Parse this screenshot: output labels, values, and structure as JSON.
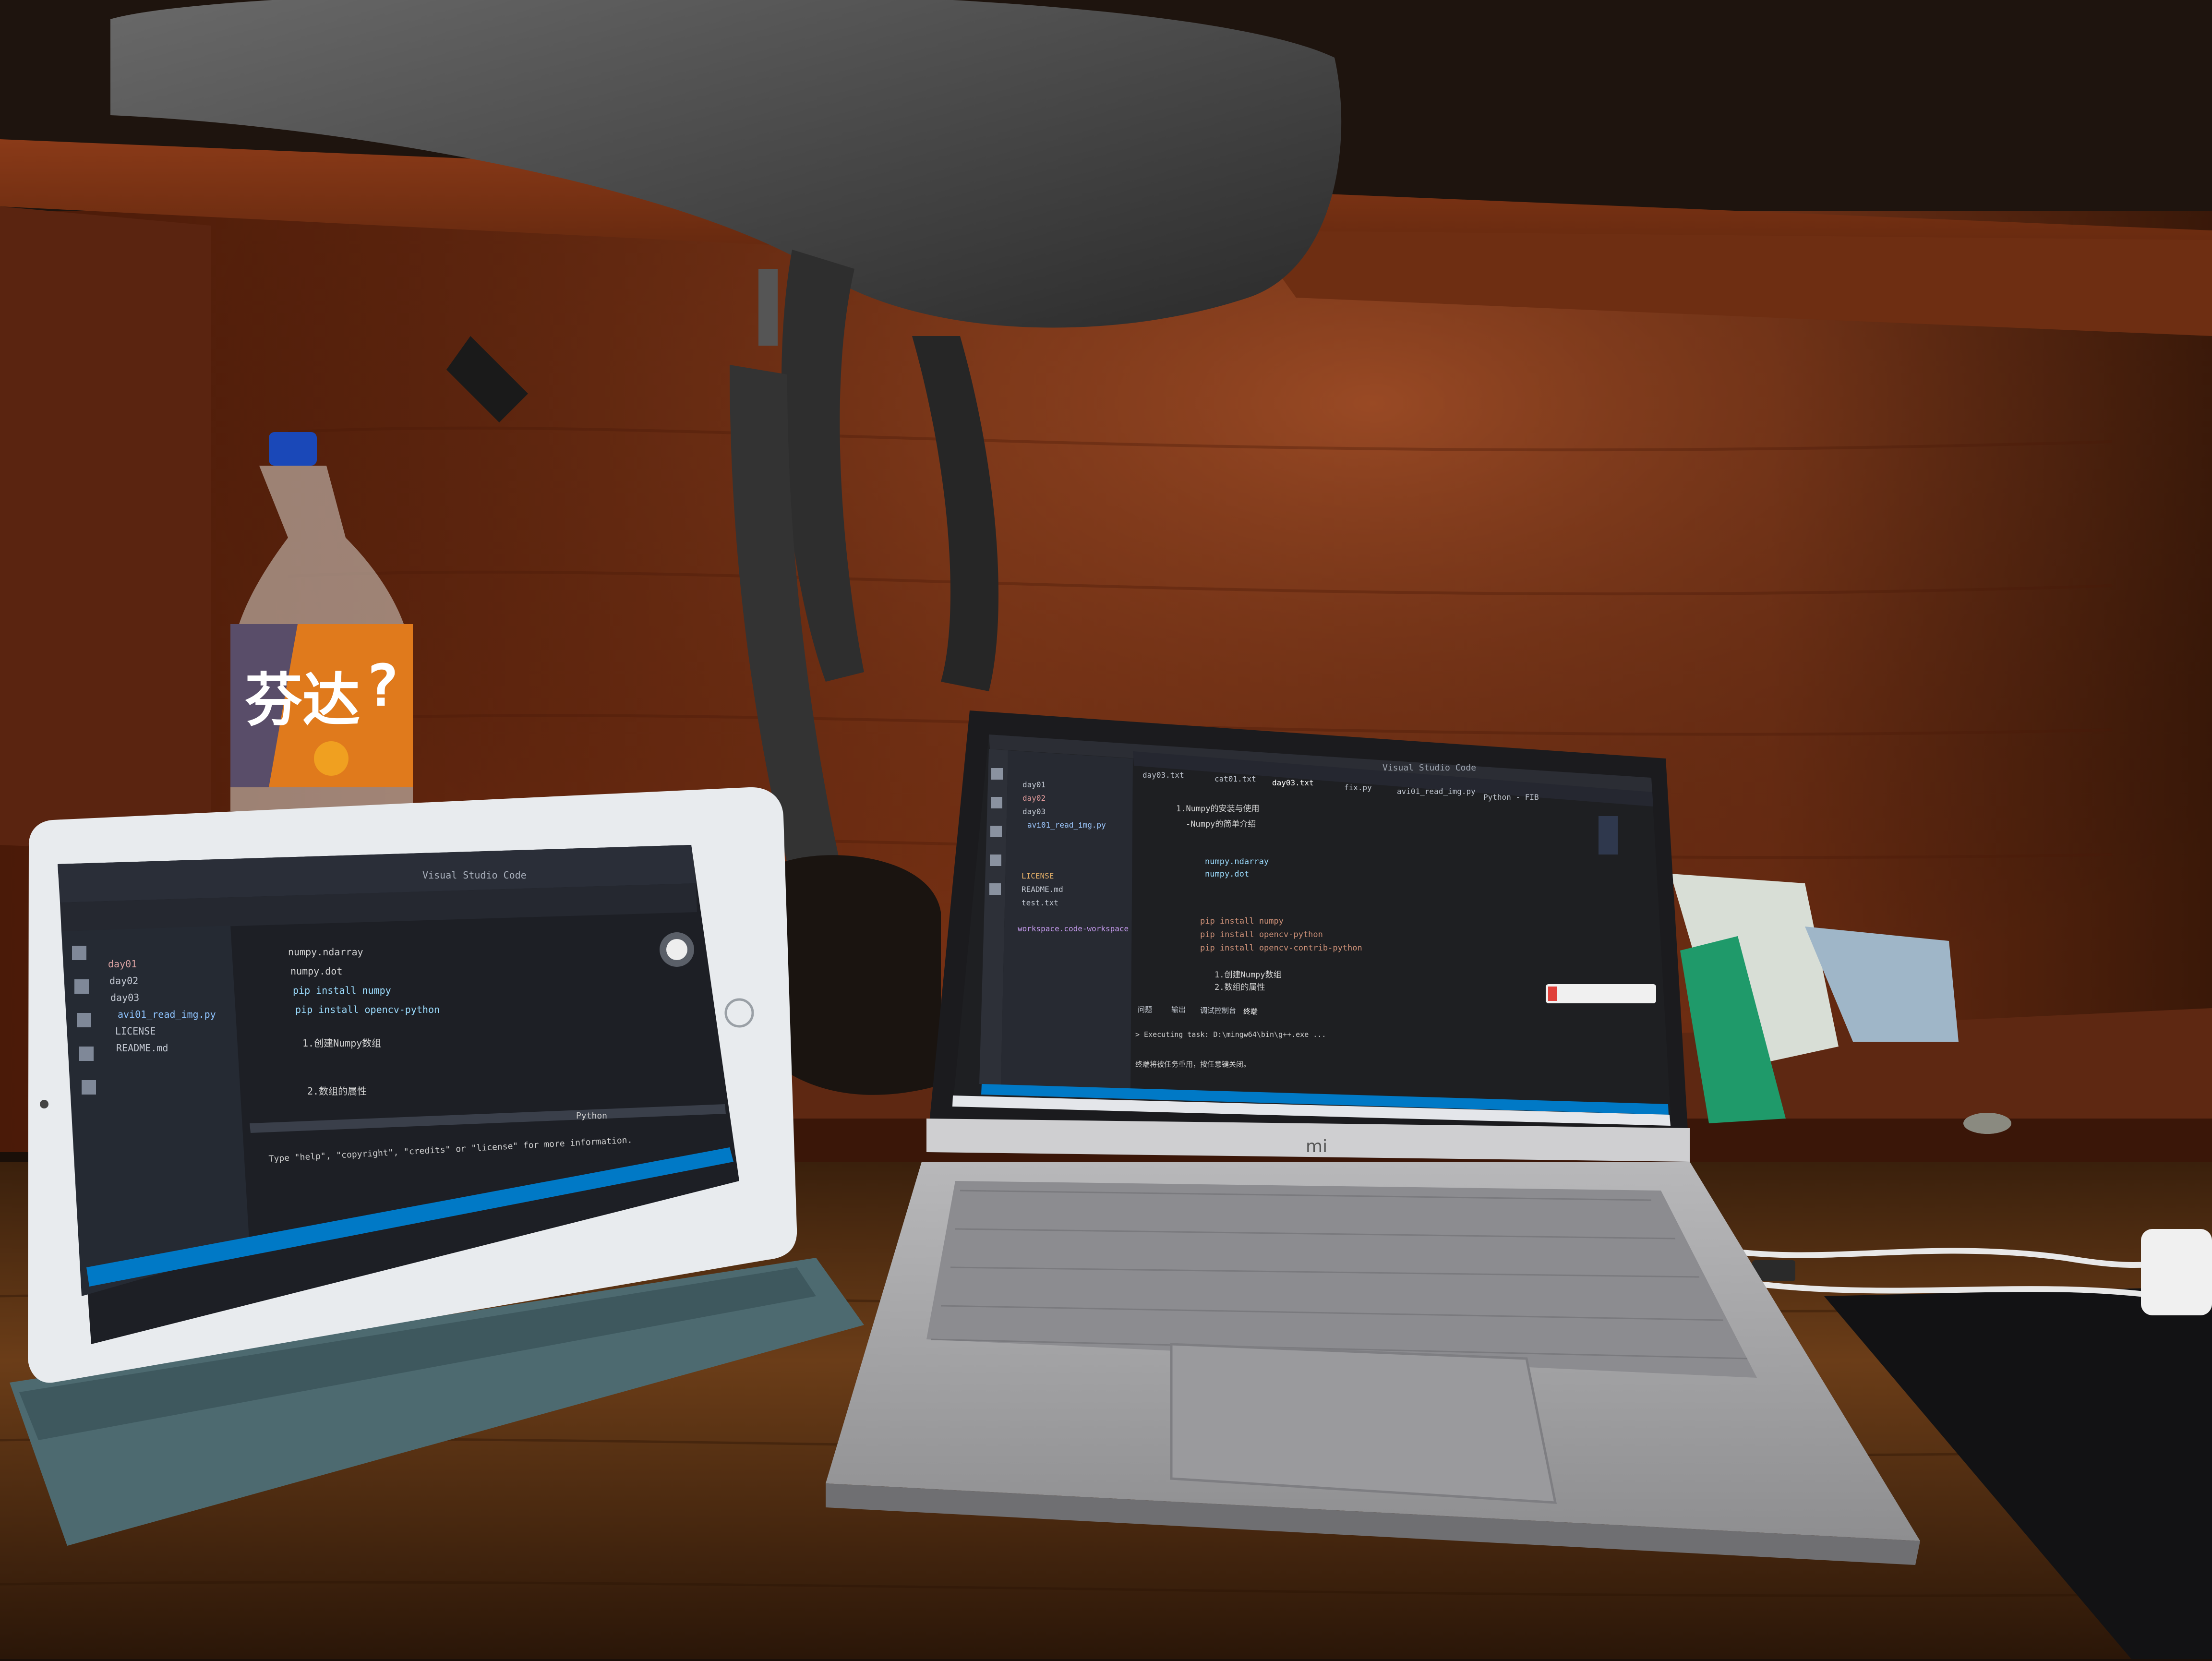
{
  "scene": {
    "description_tags": [
      "desk",
      "laptop",
      "tablet",
      "bottle",
      "backpack"
    ]
  },
  "bottle": {
    "brand_text": "芬达",
    "brand_mark": "?"
  },
  "laptop": {
    "logo": "mi",
    "window_title": "Visual Studio Code",
    "terminal_line": "> Executing task: D:\\mingw64\\bin\\g++.exe ...",
    "terminal_note": "终端将被任务重用，按任意键关闭。",
    "editor_lines": [
      "1.Numpy的安装与使用",
      "  -Numpy的简单介绍",
      "numpy.ndarray",
      "numpy.dot",
      "pip install numpy",
      "pip install opencv-python",
      "pip install opencv-contrib-python",
      "1.创建Numpy数组",
      "2.数组的属性"
    ],
    "panel_tabs": [
      "问题",
      "输出",
      "调试控制台",
      "终端"
    ],
    "tab_labels": [
      "day03.txt",
      "cat01.txt",
      "day03.txt",
      "fix.py",
      "avi01_read_img.py",
      "Python - FIB"
    ],
    "sidebar_items": [
      "day01",
      "day02",
      "day03",
      "avi01_read_img.py",
      "LICENSE",
      "README.md",
      "test.txt",
      "workspace.code-workspace"
    ]
  },
  "tablet": {
    "window_title": "Visual Studio Code",
    "sidebar_items": [
      "day01",
      "day02",
      "day03",
      "avi01_read_img.py",
      "LICENSE",
      "README.md"
    ],
    "editor_lines": [
      "numpy.ndarray",
      "numpy.dot",
      "pip install numpy",
      "pip install opencv-python",
      "1.创建Numpy数组",
      "2.数组的属性"
    ],
    "terminal_line": "Type \"help\", \"copyright\", \"credits\" or \"license\" for more information.",
    "status_lang": "Python"
  },
  "colors": {
    "wall": "#6a2a12",
    "desk": "#5c3416",
    "vscode_bg": "#1e1f22",
    "vscode_sidebar": "#2a2d35",
    "status_bar": "#0079c6",
    "laptop_silver": "#a9a9ab",
    "bottle_orange": "#e07a1c"
  }
}
